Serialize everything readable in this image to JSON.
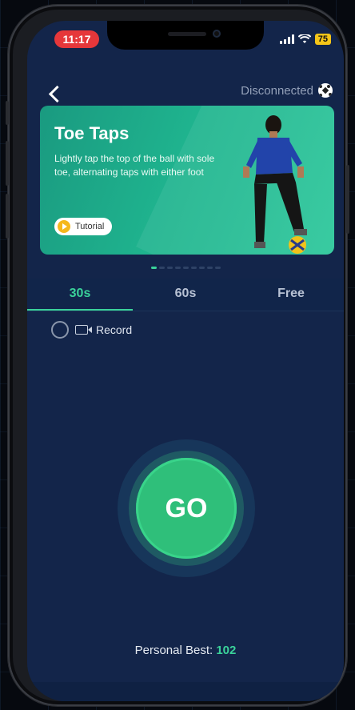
{
  "status": {
    "time": "11:17",
    "battery": "75"
  },
  "header": {
    "back_icon": "chevron-left-icon",
    "connection_status": "Disconnected",
    "device_icon": "soccer-ball-icon"
  },
  "banner": {
    "title": "Toe Taps",
    "description": "Lightly tap the top of the ball with sole toe, alternating taps with either foot",
    "tutorial_label": "Tutorial",
    "page_count": 9,
    "active_page": 0
  },
  "tabs": [
    {
      "label": "30s",
      "active": true
    },
    {
      "label": "60s",
      "active": false
    },
    {
      "label": "Free",
      "active": false
    }
  ],
  "record": {
    "label": "Record",
    "checked": false
  },
  "go_button": {
    "label": "GO"
  },
  "personal_best": {
    "label": "Personal Best:",
    "value": "102"
  },
  "colors": {
    "accent": "#3ad29a",
    "banner": "#1fb38e",
    "background": "#13254a",
    "time_pill": "#e6373a"
  }
}
